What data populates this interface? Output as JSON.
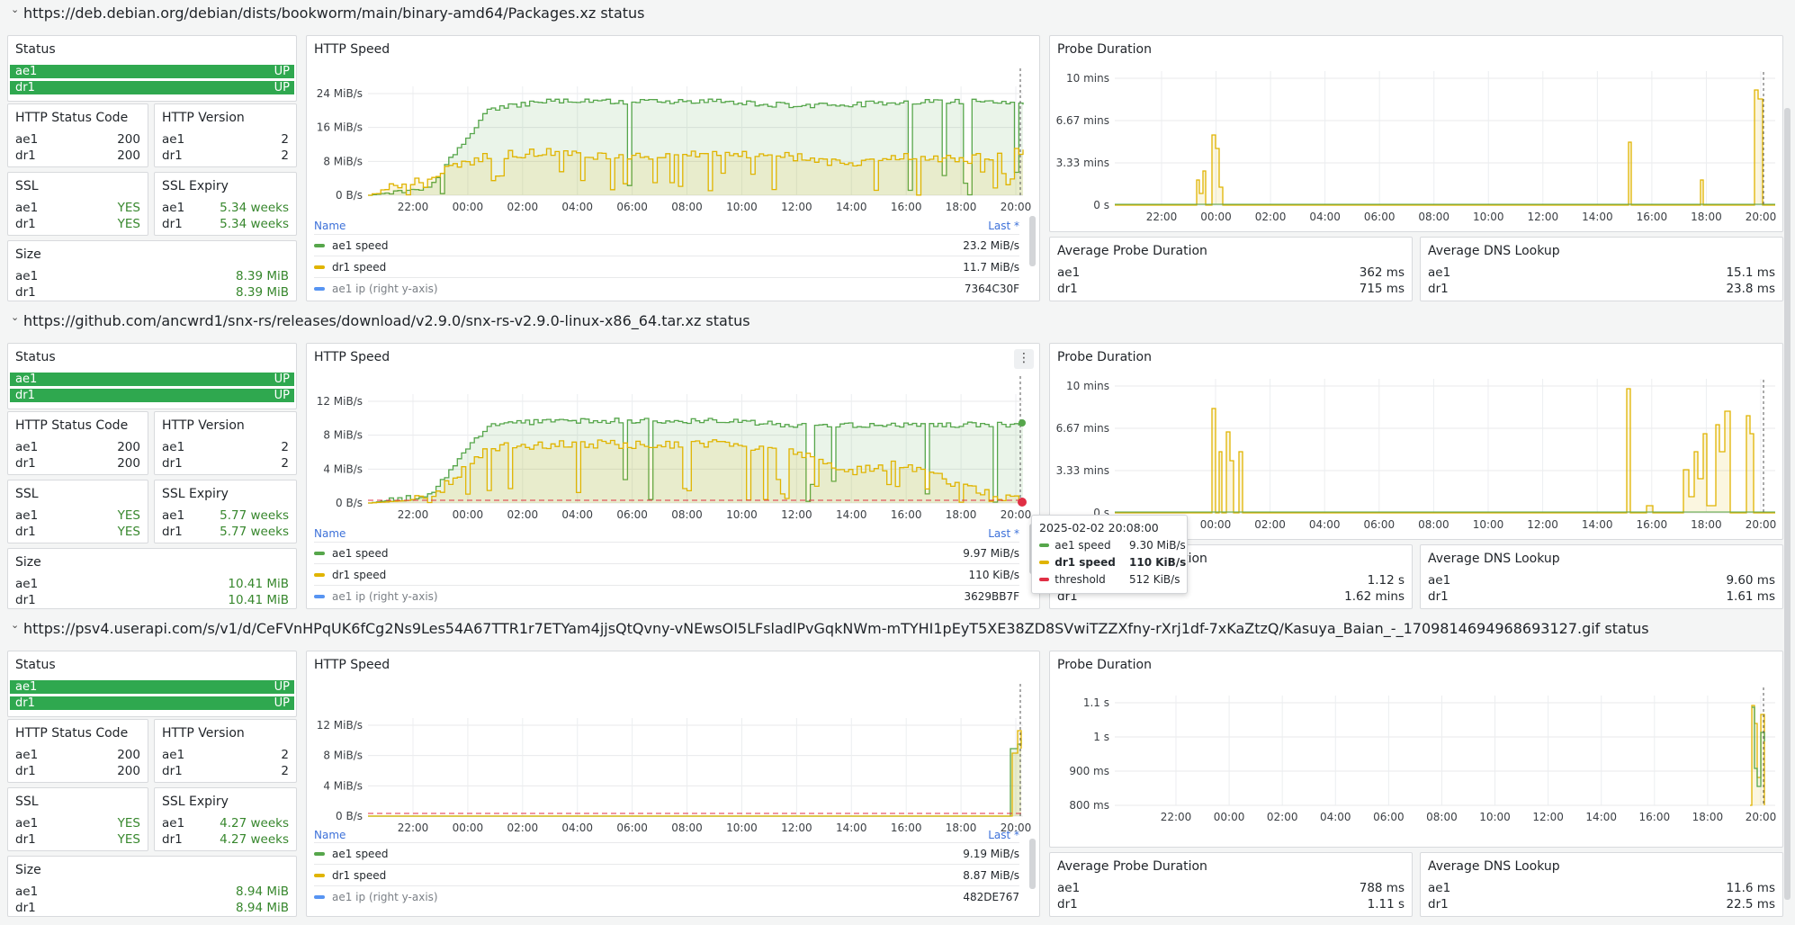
{
  "colors": {
    "green": "#56a64b",
    "yellow": "#e0b400",
    "red": "#e02f44",
    "blue": "#5794f2",
    "up": "#2fa84f"
  },
  "rows": [
    {
      "title": "https://deb.debian.org/debian/dists/bookworm/main/binary-amd64/Packages.xz status",
      "status": {
        "title": "Status",
        "items": [
          {
            "name": "ae1",
            "value": "UP"
          },
          {
            "name": "dr1",
            "value": "UP"
          }
        ]
      },
      "http_status_code": {
        "title": "HTTP Status Code",
        "items": [
          {
            "name": "ae1",
            "value": "200"
          },
          {
            "name": "dr1",
            "value": "200"
          }
        ]
      },
      "http_version": {
        "title": "HTTP Version",
        "items": [
          {
            "name": "ae1",
            "value": "2"
          },
          {
            "name": "dr1",
            "value": "2"
          }
        ]
      },
      "ssl": {
        "title": "SSL",
        "items": [
          {
            "name": "ae1",
            "value": "YES"
          },
          {
            "name": "dr1",
            "value": "YES"
          }
        ]
      },
      "ssl_expiry": {
        "title": "SSL Expiry",
        "items": [
          {
            "name": "ae1",
            "value": "5.34 weeks"
          },
          {
            "name": "dr1",
            "value": "5.34 weeks"
          }
        ]
      },
      "size": {
        "title": "Size",
        "items": [
          {
            "name": "ae1",
            "value": "8.39 MiB"
          },
          {
            "name": "dr1",
            "value": "8.39 MiB"
          }
        ]
      },
      "speed": {
        "title": "HTTP Speed",
        "yticks": [
          "24 MiB/s",
          "16 MiB/s",
          "8 MiB/s",
          "0 B/s"
        ],
        "xticks": [
          "22:00",
          "00:00",
          "02:00",
          "04:00",
          "06:00",
          "08:00",
          "10:00",
          "12:00",
          "14:00",
          "16:00",
          "18:00",
          "20:00"
        ],
        "legend_name": "Name",
        "legend_last": "Last *",
        "legend": [
          {
            "name": "ae1 speed",
            "value": "23.2 MiB/s"
          },
          {
            "name": "dr1 speed",
            "value": "11.7 MiB/s"
          },
          {
            "name": "ae1 ip (right y-axis)",
            "value": "7364C30F"
          }
        ]
      },
      "probe": {
        "title": "Probe Duration",
        "yticks": [
          "10 mins",
          "6.67 mins",
          "3.33 mins",
          "0 s"
        ],
        "xticks": [
          "22:00",
          "00:00",
          "02:00",
          "04:00",
          "06:00",
          "08:00",
          "10:00",
          "12:00",
          "14:00",
          "16:00",
          "18:00",
          "20:00"
        ]
      },
      "avg_probe": {
        "title": "Average Probe Duration",
        "items": [
          {
            "name": "ae1",
            "value": "362 ms"
          },
          {
            "name": "dr1",
            "value": "715 ms"
          }
        ]
      },
      "avg_dns": {
        "title": "Average DNS Lookup",
        "items": [
          {
            "name": "ae1",
            "value": "15.1 ms"
          },
          {
            "name": "dr1",
            "value": "23.8 ms"
          }
        ]
      }
    },
    {
      "title": "https://github.com/ancwrd1/snx-rs/releases/download/v2.9.0/snx-rs-v2.9.0-linux-x86_64.tar.xz status",
      "status": {
        "title": "Status",
        "items": [
          {
            "name": "ae1",
            "value": "UP"
          },
          {
            "name": "dr1",
            "value": "UP"
          }
        ]
      },
      "http_status_code": {
        "title": "HTTP Status Code",
        "items": [
          {
            "name": "ae1",
            "value": "200"
          },
          {
            "name": "dr1",
            "value": "200"
          }
        ]
      },
      "http_version": {
        "title": "HTTP Version",
        "items": [
          {
            "name": "ae1",
            "value": "2"
          },
          {
            "name": "dr1",
            "value": "2"
          }
        ]
      },
      "ssl": {
        "title": "SSL",
        "items": [
          {
            "name": "ae1",
            "value": "YES"
          },
          {
            "name": "dr1",
            "value": "YES"
          }
        ]
      },
      "ssl_expiry": {
        "title": "SSL Expiry",
        "items": [
          {
            "name": "ae1",
            "value": "5.77 weeks"
          },
          {
            "name": "dr1",
            "value": "5.77 weeks"
          }
        ]
      },
      "size": {
        "title": "Size",
        "items": [
          {
            "name": "ae1",
            "value": "10.41 MiB"
          },
          {
            "name": "dr1",
            "value": "10.41 MiB"
          }
        ]
      },
      "speed": {
        "title": "HTTP Speed",
        "yticks": [
          "12 MiB/s",
          "8 MiB/s",
          "4 MiB/s",
          "0 B/s"
        ],
        "xticks": [
          "22:00",
          "00:00",
          "02:00",
          "04:00",
          "06:00",
          "08:00",
          "10:00",
          "12:00",
          "14:00",
          "16:00",
          "18:00",
          "20:00"
        ],
        "legend_name": "Name",
        "legend_last": "Last *",
        "legend": [
          {
            "name": "ae1 speed",
            "value": "9.97 MiB/s"
          },
          {
            "name": "dr1 speed",
            "value": "110 KiB/s"
          },
          {
            "name": "ae1 ip (right y-axis)",
            "value": "3629BB7F"
          }
        ]
      },
      "probe": {
        "title": "Probe Duration",
        "yticks": [
          "10 mins",
          "6.67 mins",
          "3.33 mins",
          "0 s"
        ],
        "xticks": [
          "00:00",
          "02:00",
          "04:00",
          "06:00",
          "08:00",
          "10:00",
          "12:00",
          "14:00",
          "16:00",
          "18:00",
          "20:00"
        ]
      },
      "avg_probe": {
        "title": "Average Probe Duration",
        "items": [
          {
            "name": "ae1",
            "value": "1.12 s"
          },
          {
            "name": "dr1",
            "value": "1.62 mins"
          }
        ]
      },
      "avg_dns": {
        "title": "Average DNS Lookup",
        "items": [
          {
            "name": "ae1",
            "value": "9.60 ms"
          },
          {
            "name": "dr1",
            "value": "1.61 ms"
          }
        ]
      }
    },
    {
      "title": "https://psv4.userapi.com/s/v1/d/CeFVnHPqUK6fCg2Ns9Les54A67TTR1r7ETYam4jjsQtQvny-vNEwsOI5LFsladlPvGqkNWm-mTYHI1pEyT5XE38ZD8SVwiTZZXfny-rXrj1df-7xKaZtzQ/Kasuya_Baian_-_1709814694968693127.gif status",
      "status": {
        "title": "Status",
        "items": [
          {
            "name": "ae1",
            "value": "UP"
          },
          {
            "name": "dr1",
            "value": "UP"
          }
        ]
      },
      "http_status_code": {
        "title": "HTTP Status Code",
        "items": [
          {
            "name": "ae1",
            "value": "200"
          },
          {
            "name": "dr1",
            "value": "200"
          }
        ]
      },
      "http_version": {
        "title": "HTTP Version",
        "items": [
          {
            "name": "ae1",
            "value": "2"
          },
          {
            "name": "dr1",
            "value": "2"
          }
        ]
      },
      "ssl": {
        "title": "SSL",
        "items": [
          {
            "name": "ae1",
            "value": "YES"
          },
          {
            "name": "dr1",
            "value": "YES"
          }
        ]
      },
      "ssl_expiry": {
        "title": "SSL Expiry",
        "items": [
          {
            "name": "ae1",
            "value": "4.27 weeks"
          },
          {
            "name": "dr1",
            "value": "4.27 weeks"
          }
        ]
      },
      "size": {
        "title": "Size",
        "items": [
          {
            "name": "ae1",
            "value": "8.94 MiB"
          },
          {
            "name": "dr1",
            "value": "8.94 MiB"
          }
        ]
      },
      "speed": {
        "title": "HTTP Speed",
        "yticks": [
          "12 MiB/s",
          "8 MiB/s",
          "4 MiB/s",
          "0 B/s"
        ],
        "xticks": [
          "22:00",
          "00:00",
          "02:00",
          "04:00",
          "06:00",
          "08:00",
          "10:00",
          "12:00",
          "14:00",
          "16:00",
          "18:00",
          "20:00"
        ],
        "legend_name": "Name",
        "legend_last": "Last *",
        "legend": [
          {
            "name": "ae1 speed",
            "value": "9.19 MiB/s"
          },
          {
            "name": "dr1 speed",
            "value": "8.87 MiB/s"
          },
          {
            "name": "ae1 ip (right y-axis)",
            "value": "482DE767"
          }
        ]
      },
      "probe": {
        "title": "Probe Duration",
        "yticks": [
          "1.1 s",
          "1 s",
          "900 ms",
          "800 ms"
        ],
        "xticks": [
          "22:00",
          "00:00",
          "02:00",
          "04:00",
          "06:00",
          "08:00",
          "10:00",
          "12:00",
          "14:00",
          "16:00",
          "18:00",
          "20:00"
        ]
      },
      "avg_probe": {
        "title": "Average Probe Duration",
        "items": [
          {
            "name": "ae1",
            "value": "788 ms"
          },
          {
            "name": "dr1",
            "value": "1.11 s"
          }
        ]
      },
      "avg_dns": {
        "title": "Average DNS Lookup",
        "items": [
          {
            "name": "ae1",
            "value": "11.6 ms"
          },
          {
            "name": "dr1",
            "value": "22.5 ms"
          }
        ]
      }
    }
  ],
  "tooltip": {
    "time": "2025-02-02 20:08:00",
    "items": [
      {
        "name": "ae1 speed",
        "value": "9.30 MiB/s"
      },
      {
        "name": "dr1 speed",
        "value": "110 KiB/s"
      },
      {
        "name": "threshold",
        "value": "512 KiB/s"
      }
    ]
  },
  "chart_data": [
    {
      "type": "line",
      "title": "HTTP Speed",
      "x": [
        "22:00",
        "00:00",
        "02:00",
        "04:00",
        "06:00",
        "08:00",
        "10:00",
        "12:00",
        "14:00",
        "16:00",
        "18:00",
        "20:00"
      ],
      "series": [
        {
          "name": "ae1 speed",
          "values": [
            0,
            2,
            22,
            24,
            24,
            24,
            24,
            23,
            23,
            24,
            24,
            23.2
          ]
        },
        {
          "name": "dr1 speed",
          "values": [
            0,
            5,
            10,
            11,
            10,
            10,
            11,
            10,
            8,
            10,
            9,
            11.7
          ]
        }
      ],
      "yticks": [
        "0 B/s",
        "8 MiB/s",
        "16 MiB/s",
        "24 MiB/s"
      ],
      "ylim": [
        0,
        26
      ]
    },
    {
      "type": "line",
      "title": "Probe Duration",
      "x": [
        "22:00",
        "00:00",
        "02:00",
        "04:00",
        "06:00",
        "08:00",
        "10:00",
        "12:00",
        "14:00",
        "16:00",
        "18:00",
        "20:00"
      ],
      "series": [
        {
          "name": "dr1",
          "values": [
            0,
            5.5,
            0.2,
            0,
            0,
            0,
            0,
            0,
            0,
            5.5,
            1.5,
            9
          ]
        }
      ],
      "yticks": [
        "0 s",
        "3.33 mins",
        "6.67 mins",
        "10 mins"
      ],
      "ylim": [
        0,
        10
      ]
    },
    {
      "type": "line",
      "title": "HTTP Speed",
      "x": [
        "22:00",
        "00:00",
        "02:00",
        "04:00",
        "06:00",
        "08:00",
        "10:00",
        "12:00",
        "14:00",
        "16:00",
        "18:00",
        "20:00"
      ],
      "series": [
        {
          "name": "ae1 speed",
          "values": [
            0,
            1,
            10,
            10.5,
            10.5,
            10.5,
            10.5,
            10,
            10,
            10,
            10,
            9.97
          ]
        },
        {
          "name": "dr1 speed",
          "values": [
            0,
            0.5,
            7,
            7.5,
            7.5,
            7.5,
            7.5,
            7,
            4,
            5,
            2,
            0.1
          ]
        },
        {
          "name": "threshold",
          "values": [
            0.5,
            0.5,
            0.5,
            0.5,
            0.5,
            0.5,
            0.5,
            0.5,
            0.5,
            0.5,
            0.5,
            0.5
          ]
        }
      ],
      "yticks": [
        "0 B/s",
        "4 MiB/s",
        "8 MiB/s",
        "12 MiB/s"
      ],
      "ylim": [
        0,
        13
      ]
    },
    {
      "type": "line",
      "title": "Probe Duration",
      "x": [
        "00:00",
        "02:00",
        "04:00",
        "06:00",
        "08:00",
        "10:00",
        "12:00",
        "14:00",
        "16:00",
        "18:00",
        "20:00"
      ],
      "series": [
        {
          "name": "dr1",
          "values": [
            7.5,
            0.2,
            0.2,
            0,
            0,
            0,
            0,
            0.3,
            9,
            4,
            6.5
          ]
        }
      ],
      "yticks": [
        "0 s",
        "3.33 mins",
        "6.67 mins",
        "10 mins"
      ],
      "ylim": [
        0,
        10
      ]
    },
    {
      "type": "line",
      "title": "HTTP Speed",
      "x": [
        "22:00",
        "00:00",
        "02:00",
        "04:00",
        "06:00",
        "08:00",
        "10:00",
        "12:00",
        "14:00",
        "16:00",
        "18:00",
        "20:00"
      ],
      "series": [
        {
          "name": "ae1 speed",
          "values": [
            0,
            0,
            0,
            0,
            0,
            0,
            0,
            0,
            0,
            0,
            0,
            9.19
          ]
        },
        {
          "name": "dr1 speed",
          "values": [
            0,
            0,
            0,
            0,
            0,
            0,
            0,
            0,
            0,
            0,
            0,
            8.87
          ]
        },
        {
          "name": "threshold",
          "values": [
            0.5,
            0.5,
            0.5,
            0.5,
            0.5,
            0.5,
            0.5,
            0.5,
            0.5,
            0.5,
            0.5,
            0.5
          ]
        }
      ],
      "yticks": [
        "0 B/s",
        "4 MiB/s",
        "8 MiB/s",
        "12 MiB/s"
      ],
      "ylim": [
        0,
        13
      ]
    },
    {
      "type": "line",
      "title": "Probe Duration",
      "x": [
        "22:00",
        "00:00",
        "02:00",
        "04:00",
        "06:00",
        "08:00",
        "10:00",
        "12:00",
        "14:00",
        "16:00",
        "18:00",
        "20:00"
      ],
      "series": [
        {
          "name": "dr1",
          "values": [
            null,
            null,
            null,
            null,
            null,
            null,
            null,
            null,
            null,
            null,
            null,
            1.1
          ]
        }
      ],
      "yticks": [
        "800 ms",
        "900 ms",
        "1 s",
        "1.1 s"
      ],
      "ylim": [
        0.75,
        1.15
      ]
    }
  ]
}
